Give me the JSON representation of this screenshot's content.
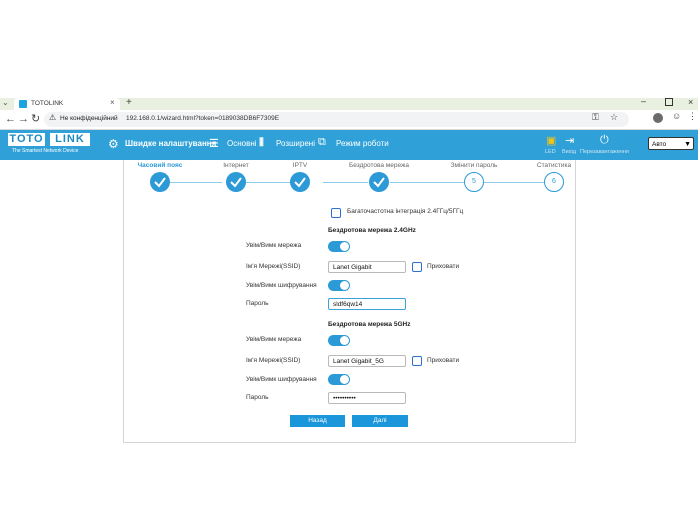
{
  "browser": {
    "tab_title": "TOTOLINK",
    "new_tab": "+",
    "url": "192.168.0.1/wizard.html?token=0189038DB6F7309E",
    "security_text": "Не конфіденційний"
  },
  "header": {
    "logo_left": "TOTO",
    "logo_right": "LINK",
    "tagline": "The Smartest Network Device",
    "nav": {
      "quick_setup": "Швидке налаштування",
      "basic": "Основні",
      "advanced": "Розширені",
      "work_mode": "Режим роботи"
    },
    "tools": {
      "led": "LED",
      "logout": "Вихід",
      "reboot": "Перезавантаження"
    },
    "language": "Авто"
  },
  "wizard": {
    "steps": [
      {
        "label": "Часовий пояс",
        "state": "done"
      },
      {
        "label": "Інтернет",
        "state": "done"
      },
      {
        "label": "IPTV",
        "state": "done"
      },
      {
        "label": "Бездротова мережа",
        "state": "done"
      },
      {
        "label": "Змінити пароль",
        "state": "pending",
        "number": "5"
      },
      {
        "label": "Статистика",
        "state": "pending",
        "number": "6"
      }
    ],
    "integration_label": "Багаточастотна інтеграція 2.4ГГц/5ГГц",
    "band24": {
      "title": "Бездротова мережа 2.4GHz",
      "wifi_toggle_label": "Увім/Вимк мережа",
      "ssid_label": "Ім'я Мережі(SSID)",
      "ssid_value": "Lanet Gigabit",
      "hide_label": "Приховати",
      "encryption_label": "Увім/Вимк шифрування",
      "password_label": "Пароль",
      "password_value": "sldf6qw14"
    },
    "band5": {
      "title": "Бездротова мережа 5GHz",
      "wifi_toggle_label": "Увім/Вимк мережа",
      "ssid_label": "Ім'я Мережі(SSID)",
      "ssid_value": "Lanet Gigabit_5G",
      "hide_label": "Приховати",
      "encryption_label": "Увім/Вимк шифрування",
      "password_label": "Пароль",
      "password_value": "••••••••••"
    },
    "back_button": "Назад",
    "next_button": "Далі"
  },
  "colors": {
    "header_blue": "#2fa1d8",
    "accent_blue": "#2b9ad6",
    "led_icon": "#f0c419"
  }
}
